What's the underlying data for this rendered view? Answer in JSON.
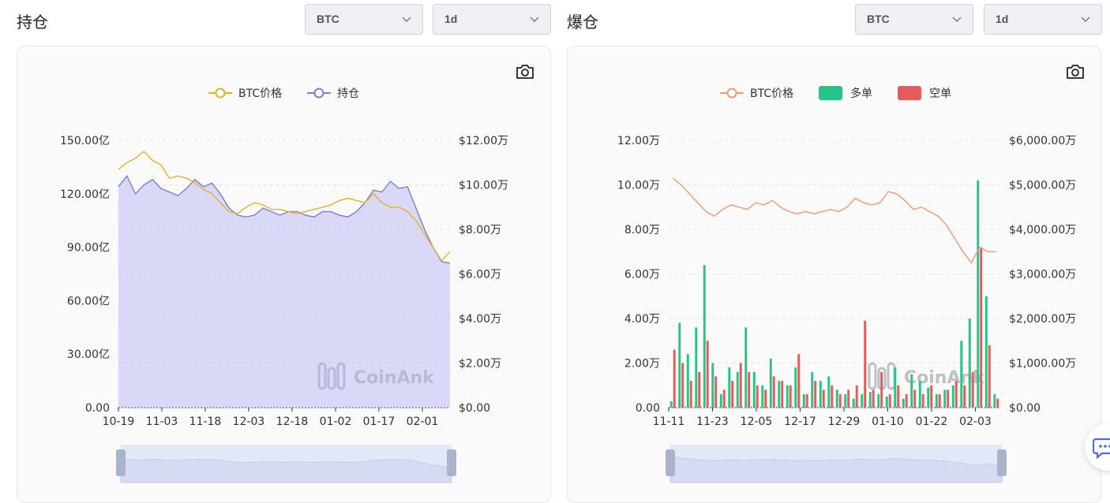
{
  "left": {
    "title": "持仓",
    "coin_select": "BTC",
    "interval_select": "1d",
    "legend": [
      {
        "name": "BTC价格",
        "color": "#e0b22a"
      },
      {
        "name": "持仓",
        "color": "#7b7fd0"
      }
    ],
    "watermark": "CoinAnk"
  },
  "right": {
    "title": "爆仓",
    "coin_select": "BTC",
    "interval_select": "1d",
    "legend": [
      {
        "name": "BTC价格",
        "color": "#ee9a74"
      },
      {
        "name": "多单",
        "color": "#26c485"
      },
      {
        "name": "空单",
        "color": "#e85a5a"
      }
    ],
    "watermark": "CoinAnk"
  },
  "chart_data": [
    {
      "type": "area",
      "title": "",
      "x_tick_labels": [
        "10-19",
        "11-03",
        "11-18",
        "12-03",
        "12-18",
        "01-02",
        "01-17",
        "02-01"
      ],
      "y_left_ticks": [
        "0.00",
        "30.00亿",
        "60.00亿",
        "90.00亿",
        "120.00亿",
        "150.00亿"
      ],
      "y_right_ticks": [
        "$0.00",
        "$2.00万",
        "$4.00万",
        "$6.00万",
        "$8.00万",
        "$10.00万",
        "$12.00万"
      ],
      "ylim_left": [
        0,
        150
      ],
      "ylim_right": [
        0,
        120000
      ],
      "grid": true,
      "legend_position": "top-center",
      "series": [
        {
          "name": "持仓",
          "kind": "area",
          "axis": "left",
          "unit": "亿",
          "color": "#7b7fd0",
          "values": [
            124,
            130,
            120,
            125,
            128,
            123,
            121,
            119,
            123,
            128,
            124,
            126,
            120,
            112,
            108,
            107,
            108,
            112,
            110,
            108,
            110,
            110,
            108,
            107,
            110,
            110,
            108,
            107,
            110,
            115,
            122,
            121,
            127,
            123,
            124,
            112,
            100,
            90,
            82,
            81
          ]
        },
        {
          "name": "BTC价格",
          "kind": "line",
          "axis": "right",
          "unit": "$",
          "color": "#e0b22a",
          "values": [
            107000,
            110000,
            112000,
            115000,
            111000,
            109000,
            103000,
            104000,
            103000,
            101000,
            98000,
            96000,
            92000,
            88000,
            87000,
            90000,
            92000,
            91000,
            89000,
            89000,
            88000,
            87000,
            88000,
            89000,
            90000,
            91000,
            93000,
            94000,
            93000,
            92000,
            96000,
            92000,
            90000,
            90000,
            88000,
            84000,
            78000,
            72000,
            66000,
            70000
          ]
        }
      ]
    },
    {
      "type": "bar",
      "title": "",
      "x_tick_labels": [
        "11-11",
        "11-23",
        "12-05",
        "12-17",
        "12-29",
        "01-10",
        "01-22",
        "02-03"
      ],
      "y_left_ticks": [
        "0.00",
        "2.00万",
        "4.00万",
        "6.00万",
        "8.00万",
        "10.00万",
        "12.00万"
      ],
      "y_right_ticks": [
        "$0.00",
        "$1,000.00万",
        "$2,000.00万",
        "$3,000.00万",
        "$4,000.00万",
        "$5,000.00万",
        "$6,000.00万"
      ],
      "ylim_left": [
        0,
        120000
      ],
      "ylim_right": [
        0,
        60000000
      ],
      "grid": true,
      "legend_position": "top-center",
      "series": [
        {
          "name": "多单",
          "kind": "bar",
          "axis": "right",
          "unit": "$",
          "color": "#26c485",
          "values": [
            1400000,
            19000000,
            12000000,
            18000000,
            32000000,
            10000000,
            3000000,
            9000000,
            8000000,
            18000000,
            8000000,
            5000000,
            11000000,
            6000000,
            5000000,
            9000000,
            3000000,
            8000000,
            6000000,
            7000000,
            4000000,
            3000000,
            2000000,
            3000000,
            3500000,
            3000000,
            2500000,
            9000000,
            2000000,
            7500000,
            6000000,
            4500000,
            3000000,
            4000000,
            5000000,
            15000000,
            20000000,
            51000000,
            25000000,
            3000000
          ]
        },
        {
          "name": "空单",
          "kind": "bar",
          "axis": "right",
          "unit": "$",
          "color": "#e85a5a",
          "values": [
            13000000,
            10000000,
            6000000,
            8000000,
            15000000,
            7000000,
            4000000,
            6000000,
            10000000,
            8000000,
            5000000,
            4000000,
            7000000,
            6000000,
            5000000,
            12000000,
            3000000,
            6000000,
            4000000,
            5000000,
            3000000,
            4000000,
            5000000,
            19500000,
            4000000,
            8000000,
            3000000,
            5000000,
            3000000,
            4000000,
            3000000,
            5000000,
            3000000,
            4000000,
            6000000,
            5000000,
            8000000,
            36000000,
            14000000,
            2000000
          ]
        },
        {
          "name": "BTC价格",
          "kind": "line",
          "axis": "left",
          "unit": "$",
          "color": "#ee9a74",
          "values": [
            103000,
            100000,
            96000,
            92000,
            88000,
            86000,
            89000,
            91000,
            90000,
            89000,
            92000,
            91000,
            93000,
            90000,
            88000,
            87000,
            88000,
            87000,
            88000,
            89000,
            88000,
            90000,
            94000,
            92000,
            91000,
            92000,
            97000,
            96000,
            93000,
            89000,
            90000,
            88000,
            86000,
            82000,
            76000,
            70000,
            65000,
            72000,
            70000,
            70000
          ]
        }
      ]
    }
  ]
}
